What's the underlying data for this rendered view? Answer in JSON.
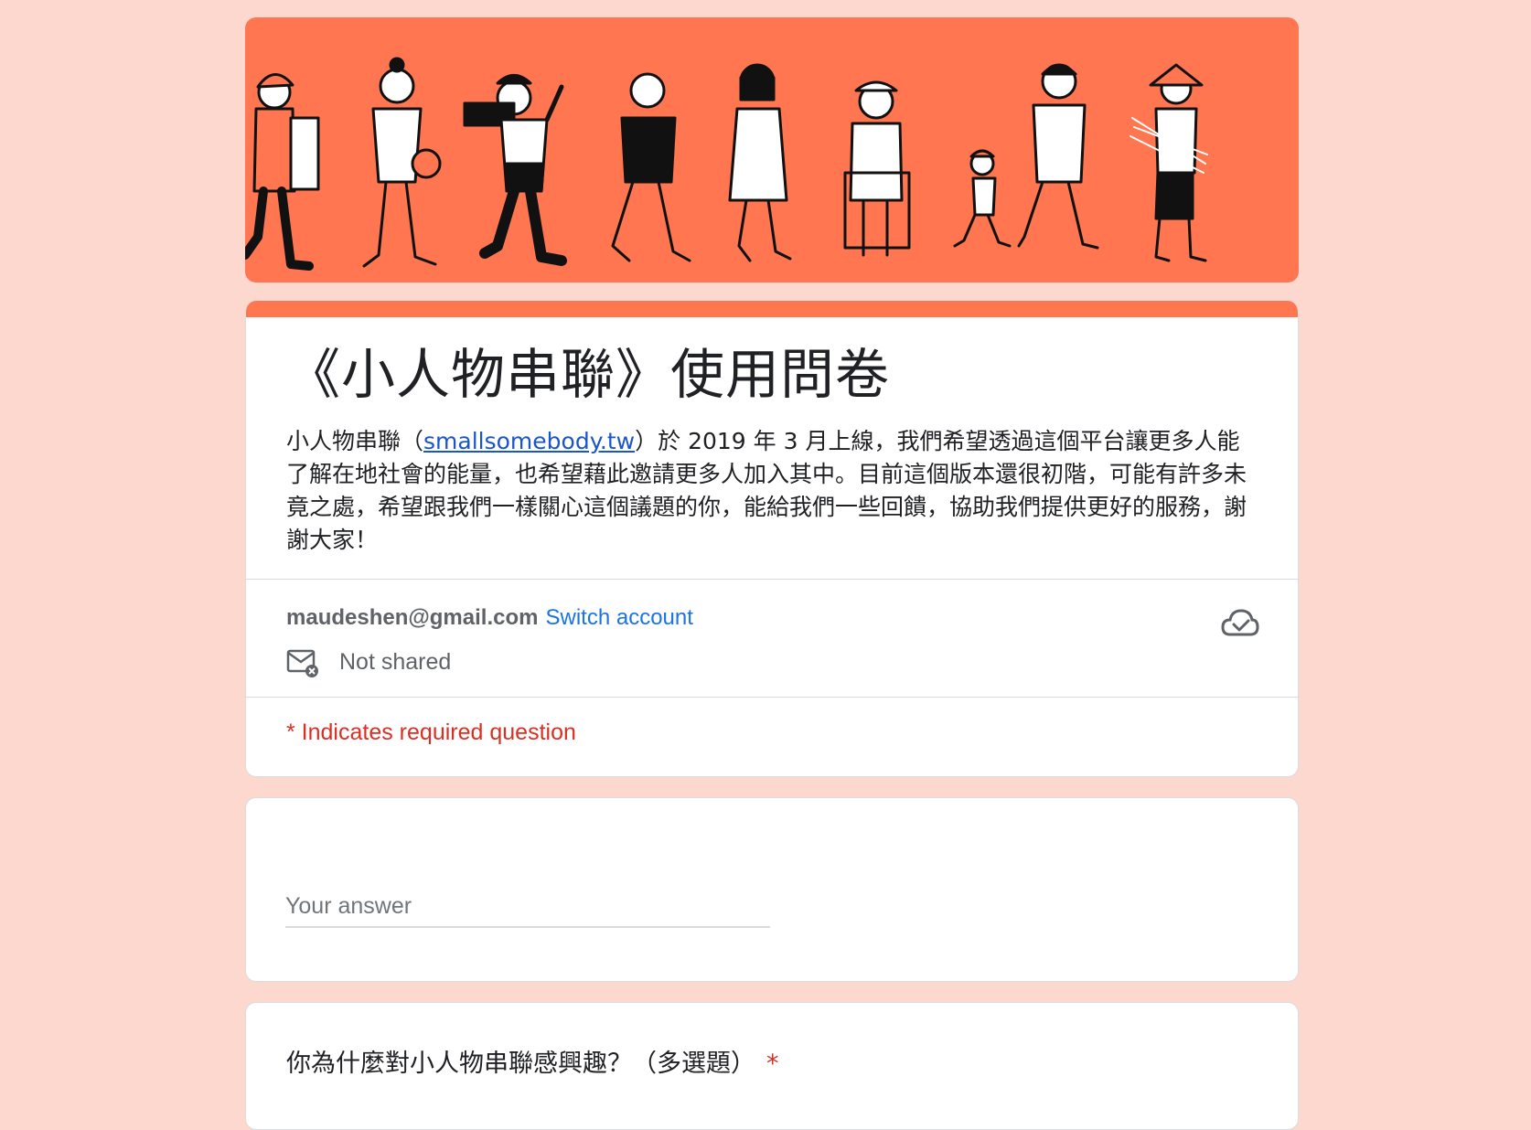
{
  "banner": {
    "background": "#ff7650",
    "figures": [
      "delivery-person",
      "student-with-ball",
      "mover-with-box",
      "old-man",
      "doctor",
      "elderly-woman-walker",
      "father-with-child",
      "farmer"
    ]
  },
  "form": {
    "title": "《小人物串聯》使用問卷",
    "description_prefix": "小人物串聯（",
    "description_link": "smallsomebody.tw",
    "description_suffix": "）於 2019 年 3 月上線，我們希望透過這個平台讓更多人能了解在地社會的能量，也希望藉此邀請更多人加入其中。目前這個版本還很初階，可能有許多未竟之處，希望跟我們一樣關心這個議題的你，能給我們一些回饋，協助我們提供更好的服務，謝謝大家！"
  },
  "account": {
    "email": "maudeshen@gmail.com",
    "switch_label": "Switch account",
    "not_shared_label": "Not shared"
  },
  "required_note": "* Indicates required question",
  "questions": [
    {
      "label": "",
      "placeholder": "Your answer"
    },
    {
      "label": "你為什麼對小人物串聯感興趣？（多選題）",
      "required_mark": "*"
    }
  ],
  "colors": {
    "accent": "#ff7650",
    "page_bg": "#fcd8cf",
    "link": "#1a73e8",
    "required": "#d93025"
  }
}
